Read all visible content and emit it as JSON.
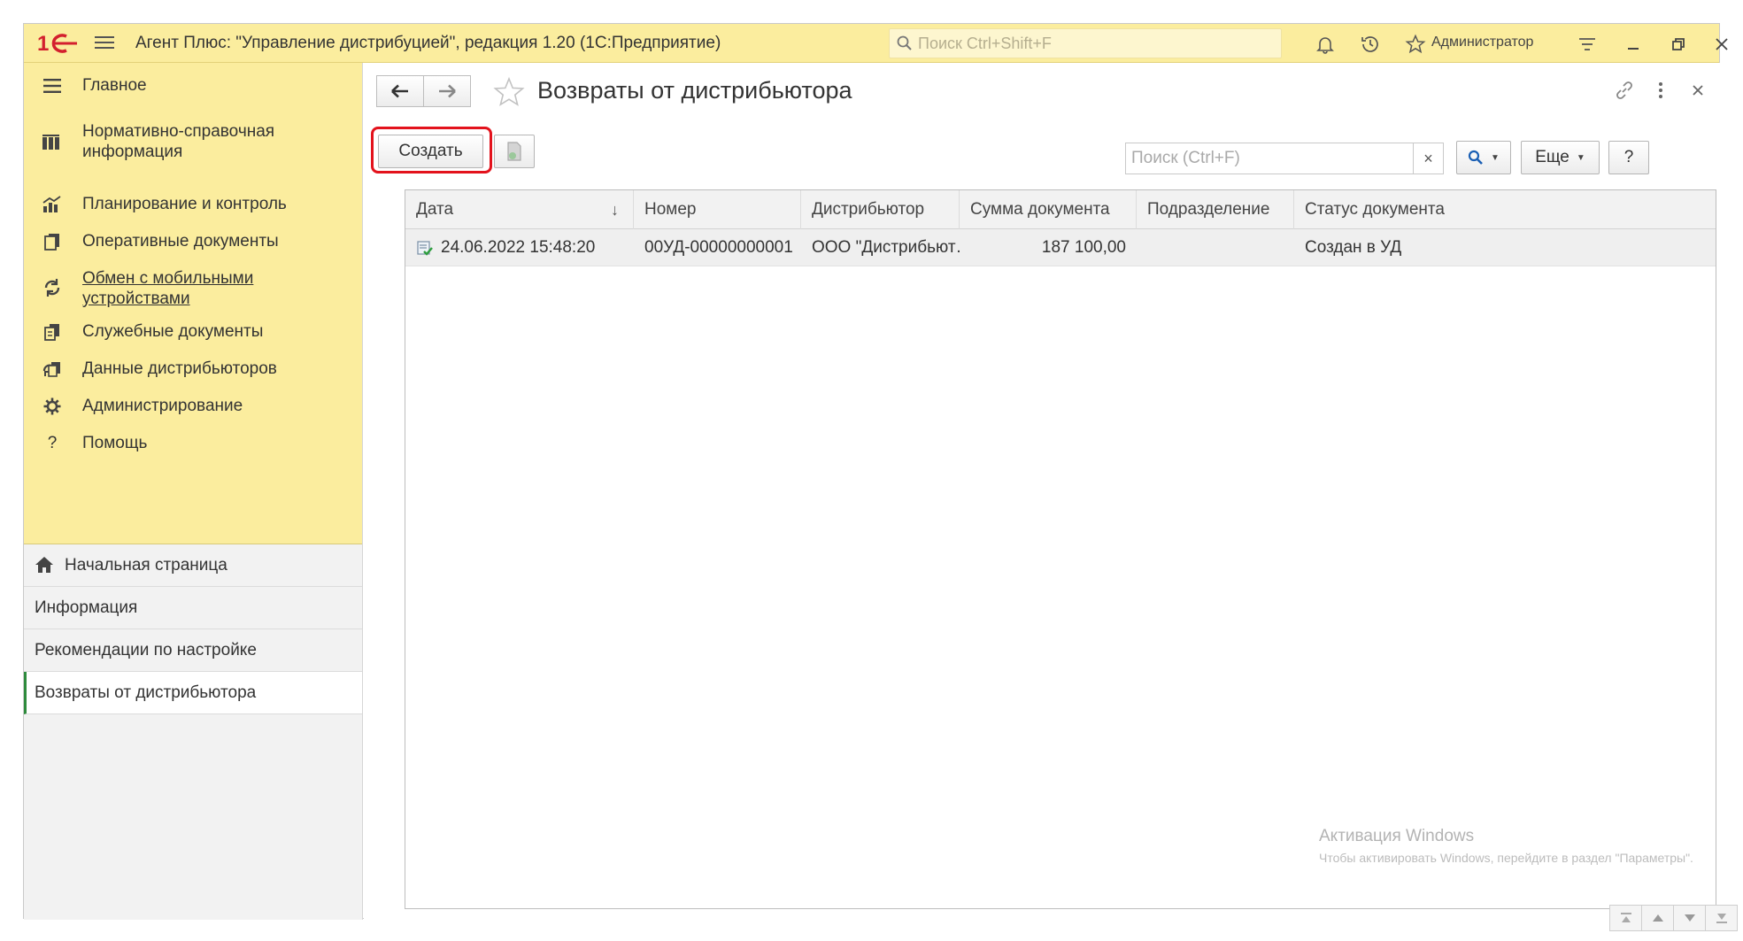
{
  "titlebar": {
    "logo_text": "1С",
    "app_title": "Агент Плюс: \"Управление дистрибуцией\", редакция 1.20  (1С:Предприятие)",
    "search_placeholder": "Поиск Ctrl+Shift+F",
    "user": "Администратор"
  },
  "sections": [
    {
      "label": "Главное",
      "icon": "hamburger-icon"
    },
    {
      "label": "Нормативно-справочная информация",
      "icon": "catalog-icon"
    },
    {
      "label": "Планирование и контроль",
      "icon": "chart-icon"
    },
    {
      "label": "Оперативные документы",
      "icon": "documents-icon"
    },
    {
      "label": "Обмен с мобильными устройствами",
      "icon": "sync-icon"
    },
    {
      "label": "Служебные документы",
      "icon": "service-docs-icon"
    },
    {
      "label": "Данные дистрибьюторов",
      "icon": "distributor-data-icon"
    },
    {
      "label": "Администрирование",
      "icon": "gear-icon"
    },
    {
      "label": "Помощь",
      "icon": "help-icon"
    }
  ],
  "open_windows": [
    {
      "label": "Начальная страница",
      "icon": "home-icon"
    },
    {
      "label": "Информация"
    },
    {
      "label": "Рекомендации по настройке"
    },
    {
      "label": "Возвраты от дистрибьютора"
    }
  ],
  "form": {
    "title": "Возвраты от дистрибьютора",
    "create_label": "Создать",
    "search_placeholder": "Поиск (Ctrl+F)",
    "clear_label": "×",
    "more_label": "Еще",
    "help_label": "?"
  },
  "table": {
    "columns": [
      "Дата",
      "Номер",
      "Дистрибьютор",
      "Сумма документа",
      "Подразделение",
      "Статус документа"
    ],
    "sort_indicator": "↓",
    "rows": [
      {
        "date": "24.06.2022 15:48:20",
        "number": "00УД-00000000001",
        "distributor": "ООО \"Дистрибьют…",
        "amount": "187 100,00",
        "division": "",
        "status": "Создан в УД"
      }
    ]
  },
  "watermark": {
    "line1": "Активация Windows",
    "line2": "Чтобы активировать Windows, перейдите в раздел \"Параметры\"."
  },
  "colors": {
    "accent_yellow": "#fbed9e",
    "highlight_red": "#e3121c",
    "active_green": "#2e8b3d",
    "logo_red": "#d3202e"
  }
}
